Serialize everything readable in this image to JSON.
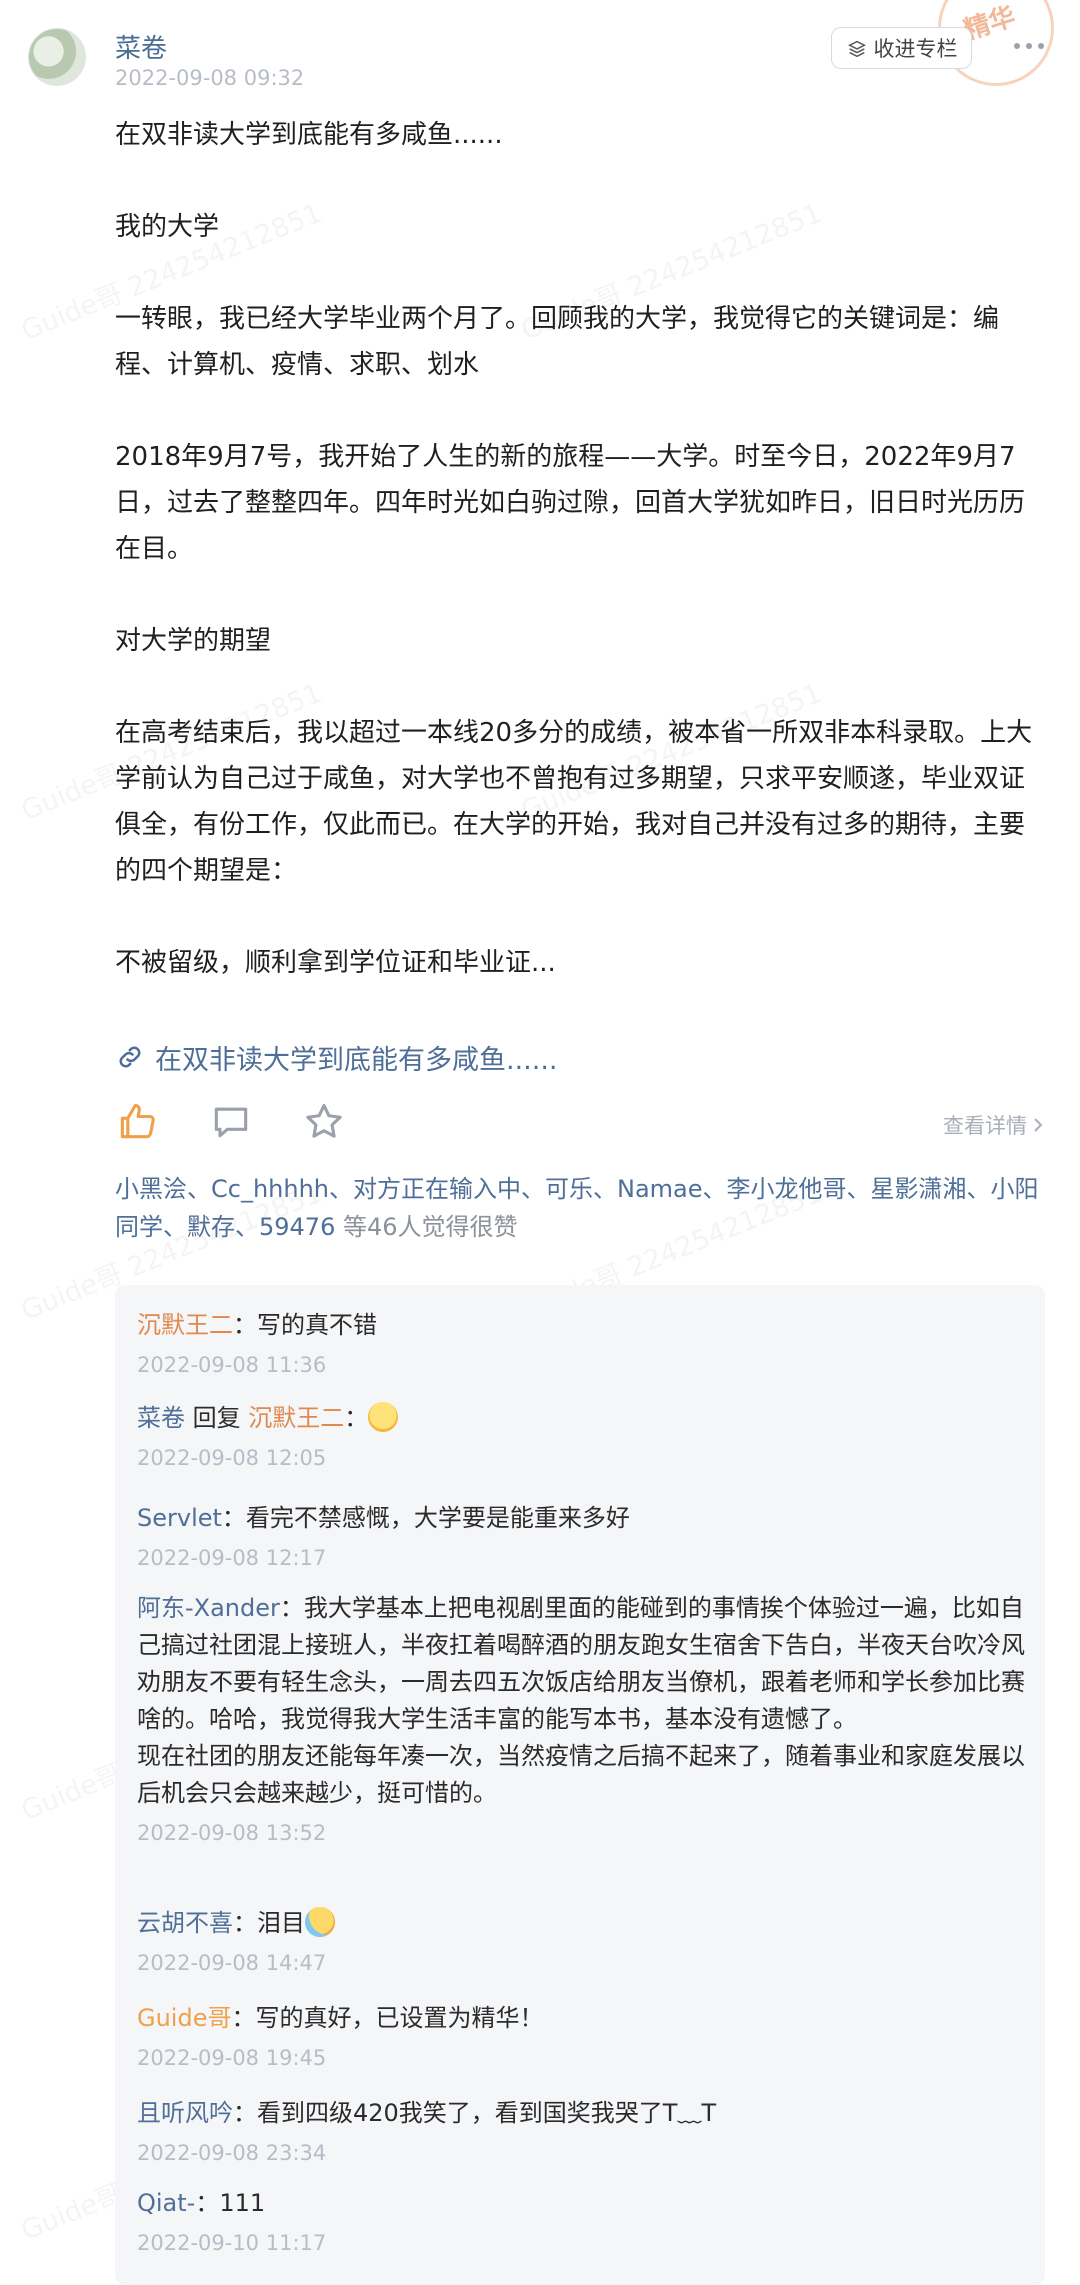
{
  "watermark": "Guide哥 224254212851",
  "header": {
    "author": "菜卷",
    "time": "2022-09-08 09:32",
    "collect_label": "收进专栏",
    "stamp_text": "精华"
  },
  "post": {
    "paragraphs": [
      "在双非读大学到底能有多咸鱼......",
      "我的大学",
      "一转眼，我已经大学毕业两个月了。回顾我的大学，我觉得它的关键词是：编程、计算机、疫情、求职、划水",
      "2018年9月7号，我开始了人生的新的旅程——大学。时至今日，2022年9月7日，过去了整整四年。四年时光如白驹过隙，回首大学犹如昨日，旧日时光历历在目。",
      "对大学的期望",
      "在高考结束后，我以超过一本线20多分的成绩，被本省一所双非本科录取。上大学前认为自己过于咸鱼，对大学也不曾抱有过多期望，只求平安顺遂，毕业双证俱全，有份工作，仅此而已。在大学的开始，我对自己并没有过多的期待，主要的四个期望是：",
      "不被留级，顺利拿到学位证和毕业证..."
    ],
    "link_text": "在双非读大学到底能有多咸鱼......"
  },
  "actions": {
    "detail_label": "查看详情"
  },
  "likes": {
    "names": "小黑浍、Cc_hhhhh、对方正在输入中、可乐、Namae、李小龙他哥、星影潇湘、小阳同学、默存、59476",
    "suffix": " 等46人觉得很赞"
  },
  "comments": [
    {
      "name": "沉默王二",
      "text": "：写的真不错",
      "time": "2022-09-08 11:36"
    },
    {
      "name": "菜卷",
      "reply_word": " 回复 ",
      "reply_to": "沉默王二",
      "text": "：",
      "emoji": "smile-emoji",
      "time": "2022-09-08 12:05"
    },
    {
      "name": "Servlet",
      "text": "：看完不禁感慨，大学要是能重来多好",
      "time": "2022-09-08 12:17"
    },
    {
      "name": "阿东-Xander",
      "text": "：我大学基本上把电视剧里面的能碰到的事情挨个体验过一遍，比如自己搞过社团混上接班人，半夜扛着喝醉酒的朋友跑女生宿舍下告白，半夜天台吹冷风劝朋友不要有轻生念头，一周去四五次饭店给朋友当僚机，跟着老师和学长参加比赛啥的。哈哈，我觉得我大学生活丰富的能写本书，基本没有遗憾了。",
      "text2": "现在社团的朋友还能每年凑一次，当然疫情之后搞不起来了，随着事业和家庭发展以后机会只会越来越少，挺可惜的。",
      "time": "2022-09-08 13:52"
    },
    {
      "name": "云胡不喜",
      "text": "：泪目",
      "emoji": "tears-emoji",
      "time": "2022-09-08 14:47"
    },
    {
      "name": "Guide哥",
      "text": "：写的真好，已设置为精华！",
      "time": "2022-09-08 19:45"
    },
    {
      "name": "且听风吟",
      "text": "：看到四级420我笑了，看到国奖我哭了T﹏T",
      "time": "2022-09-08 23:34"
    },
    {
      "name": "Qiat-",
      "text": "：111",
      "time": "2022-09-10 11:17"
    }
  ]
}
